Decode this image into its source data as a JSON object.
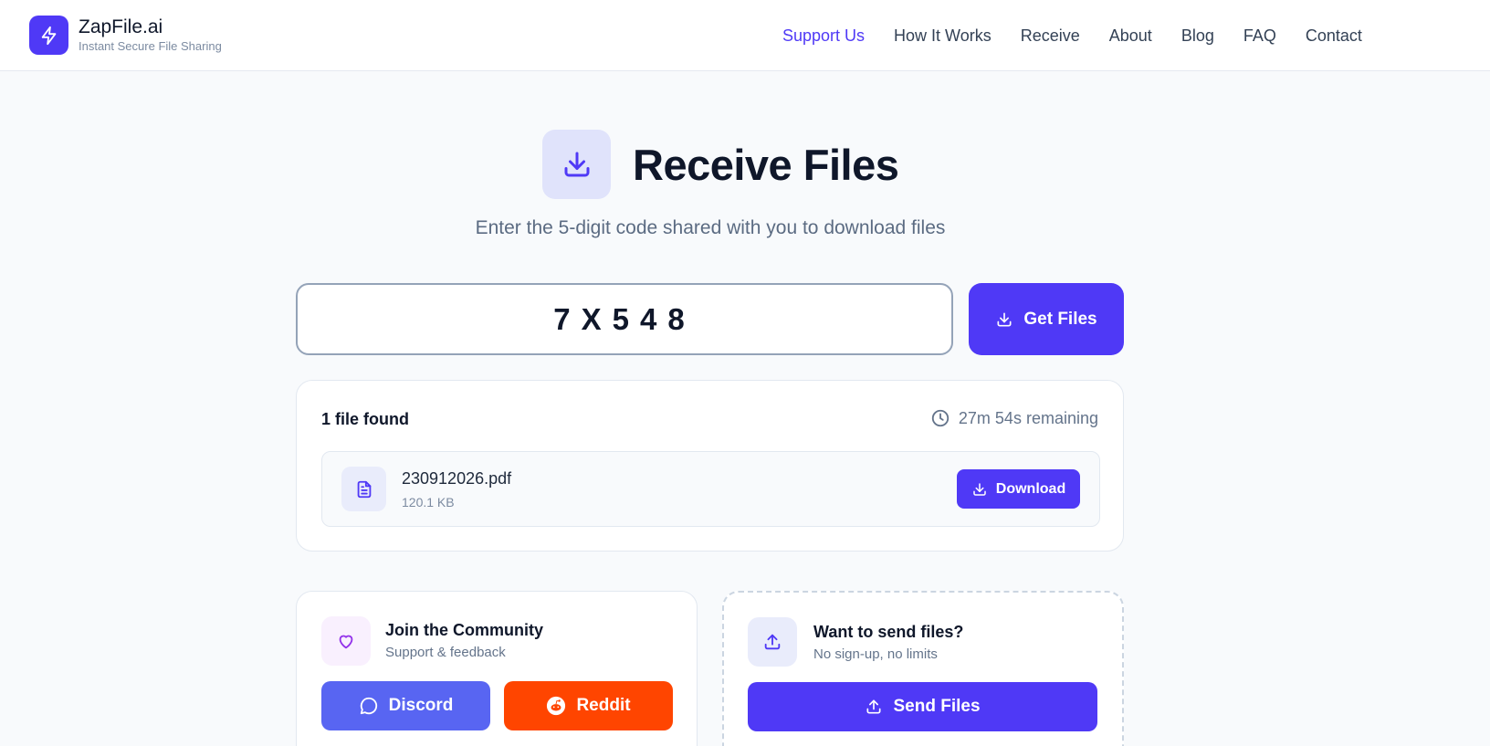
{
  "brand": {
    "name": "ZapFile.ai",
    "tagline": "Instant Secure File Sharing",
    "logo_icon": "lightning-icon",
    "accent_color": "#4f39f6"
  },
  "nav": {
    "items": [
      {
        "label": "Support Us",
        "active": true
      },
      {
        "label": "How It Works",
        "active": false
      },
      {
        "label": "Receive",
        "active": false
      },
      {
        "label": "About",
        "active": false
      },
      {
        "label": "Blog",
        "active": false
      },
      {
        "label": "FAQ",
        "active": false
      },
      {
        "label": "Contact",
        "active": false
      }
    ]
  },
  "hero": {
    "icon": "download-icon",
    "title": "Receive Files",
    "subtitle": "Enter the 5-digit code shared with you to download files"
  },
  "code_form": {
    "value": "7X548",
    "button_label": "Get Files",
    "button_icon": "download-icon"
  },
  "result": {
    "found_text": "1 file found",
    "remaining_text": "27m 54s remaining",
    "remaining_icon": "clock-icon",
    "files": [
      {
        "name": "230912026.pdf",
        "size": "120.1 KB",
        "icon": "document-icon",
        "action_label": "Download"
      }
    ]
  },
  "community": {
    "icon": "heart-icon",
    "title": "Join the Community",
    "subtitle": "Support & feedback",
    "discord_label": "Discord",
    "discord_color": "#5865f2",
    "reddit_label": "Reddit",
    "reddit_color": "#ff4500"
  },
  "send": {
    "icon": "upload-icon",
    "title": "Want to send files?",
    "subtitle": "No sign-up, no limits",
    "button_label": "Send Files"
  }
}
